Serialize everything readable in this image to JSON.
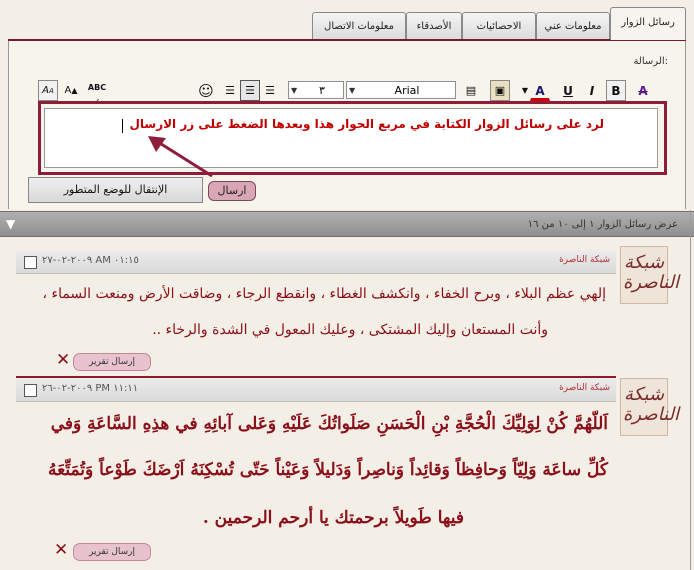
{
  "tabs": [
    {
      "label": "رسائل الزوار",
      "active": true
    },
    {
      "label": "معلومات عني"
    },
    {
      "label": "الاحصائيات"
    },
    {
      "label": "الأصدقاء"
    },
    {
      "label": "معلومات الاتصال"
    }
  ],
  "compose": {
    "label": "الرسالة:",
    "toolbar": {
      "font": "Arial",
      "size": "٣",
      "bold": "B",
      "italic": "I",
      "underline": "U",
      "font_color_letter": "A",
      "spell": "ABC",
      "smiley": "☺"
    },
    "hint": "لرد على رسائل الزوار الكتابة في مربع الحوار هذا وبعدها الضغط على زر الارسال",
    "send_label": "ارسال",
    "advanced_label": "الإنتقال للوضع المتطور"
  },
  "list_info": "عرض رسائل الزوار ١ إلى ١٠ من ١٦",
  "messages": [
    {
      "author": "شبكة الناصرة",
      "date": "٢٠٠٩-٠٢-٢٧ AM ٠١:١٥",
      "avatar_text": "شبكة الناصرة",
      "lines": [
        "إلهي عظم البلاء ، وبرح الخفاء ، وانكشف الغطاء ، وانقطع الرجاء ، وضاقت الأرض ومنعت السماء ،",
        "وأنت المستعان وإليك المشتكى ، وعليك المعول في الشدة والرخاء .."
      ],
      "report_label": "إرسال تقرير"
    },
    {
      "author": "شبكة الناصرة",
      "date": "٢٠٠٩-٠٢-٢٦ PM ١١:١١",
      "avatar_text": "شبكة الناصرة",
      "lines": [
        "اَللّهُمَّ كُنْ لِوَلِيِّكَ الْحُجَّةِ بْنِ الْحَسَنِ صَلَواتُكَ عَلَيْهِ وَعَلى آبائِهِ في هذِهِ السَّاعَةِ وَفي",
        "كُلِّ ساعَة وَلِيّاً وَحافِظاً وَقائِداً وَناصِراً وَدَليلاً وَعَيْناً حَتّى تُسْكِنَهُ اَرْضَكَ طَوْعاً وَتُمَتِّعَهُ",
        "فيها طَويلاً برحمتك يا أرحم الرحمين ."
      ],
      "report_label": "إرسال تقرير"
    }
  ],
  "colors": {
    "accent": "#8a1a2e",
    "hint": "#c00000",
    "message_text": "#8a0f1a"
  }
}
